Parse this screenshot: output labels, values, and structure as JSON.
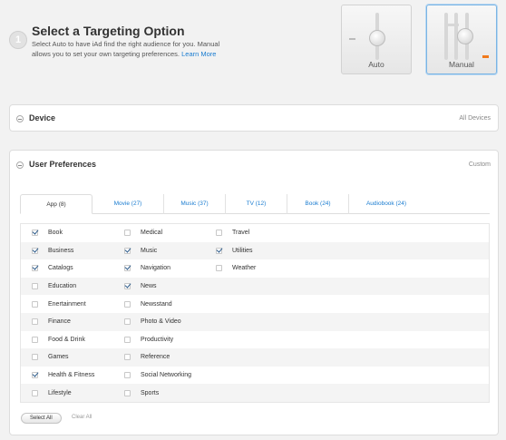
{
  "header": {
    "step": "1",
    "title": "Select a Targeting Option",
    "description": "Select Auto to have iAd find the right audience for you. Manual allows you to set your own targeting preferences.",
    "learn_more": "Learn More"
  },
  "options": {
    "auto_label": "Auto",
    "manual_label": "Manual",
    "selected": "Manual"
  },
  "device_panel": {
    "title": "Device",
    "meta": "All Devices",
    "expanded": false
  },
  "prefs_panel": {
    "title": "User Preferences",
    "meta": "Custom",
    "expanded": true,
    "tabs": [
      {
        "label": "App (8)",
        "active": true
      },
      {
        "label": "Movie (27)",
        "active": false
      },
      {
        "label": "Music (37)",
        "active": false
      },
      {
        "label": "TV (12)",
        "active": false
      },
      {
        "label": "Book (24)",
        "active": false
      },
      {
        "label": "Audiobook (24)",
        "active": false
      }
    ],
    "columns": [
      [
        {
          "label": "Book",
          "checked": true
        },
        {
          "label": "Business",
          "checked": true
        },
        {
          "label": "Catalogs",
          "checked": true
        },
        {
          "label": "Education",
          "checked": false
        },
        {
          "label": "Enertainment",
          "checked": false
        },
        {
          "label": "Finance",
          "checked": false
        },
        {
          "label": "Food & Drink",
          "checked": false
        },
        {
          "label": "Games",
          "checked": false
        },
        {
          "label": "Health & Fitness",
          "checked": true
        },
        {
          "label": "Lifestyle",
          "checked": false
        }
      ],
      [
        {
          "label": "Medical",
          "checked": false
        },
        {
          "label": "Music",
          "checked": true
        },
        {
          "label": "Navigation",
          "checked": true
        },
        {
          "label": "News",
          "checked": true
        },
        {
          "label": "Newsstand",
          "checked": false
        },
        {
          "label": "Photo & Video",
          "checked": false
        },
        {
          "label": "Productivity",
          "checked": false
        },
        {
          "label": "Reference",
          "checked": false
        },
        {
          "label": "Social Networking",
          "checked": false
        },
        {
          "label": "Sports",
          "checked": false
        }
      ],
      [
        {
          "label": "Travel",
          "checked": false
        },
        {
          "label": "Utilities",
          "checked": true
        },
        {
          "label": "Weather",
          "checked": false
        }
      ]
    ],
    "select_all": "Select All",
    "clear_all": "Clear All"
  }
}
